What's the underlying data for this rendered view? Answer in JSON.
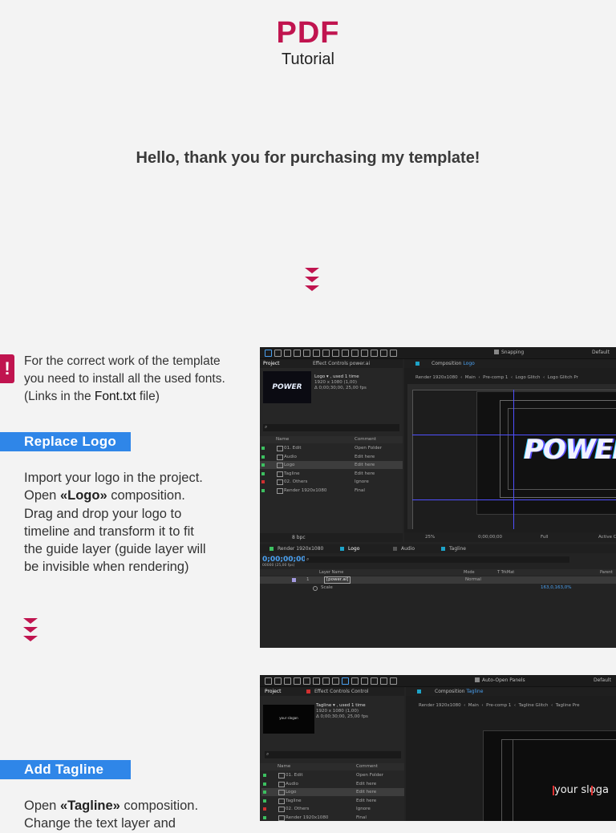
{
  "header": {
    "title": "PDF",
    "subtitle": "Tutorial"
  },
  "intro": {
    "greeting": "Hello, thank you for purchasing my template!"
  },
  "icons": {
    "chevron": "triple-chevron-down-icon",
    "warning": "exclamation-icon"
  },
  "colors": {
    "brand": "#c0144f",
    "banner": "#2f86e8",
    "background": "#f3f3f3"
  },
  "fonts_note": {
    "warning_glyph": "!",
    "line1": "For the correct work of the template",
    "line2": "you need to install all the used fonts.",
    "line3_prefix": "(Links in the ",
    "line3_file": "Font.txt",
    "line3_suffix": " file)"
  },
  "replace_logo": {
    "banner": "Replace Logo",
    "p1": "Import your logo in the project.",
    "p2_prefix": "Open ",
    "p2_bold": "«Logo»",
    "p2_suffix": " composition.",
    "p3": "Drag and drop your logo to",
    "p4": "timeline and transform it to fit",
    "p5": "the guide layer (guide layer will",
    "p6": "be invisible when rendering)"
  },
  "add_tagline": {
    "banner": "Add Tagline",
    "p1_prefix": "Open ",
    "p1_bold": "«Tagline»",
    "p1_suffix": " composition.",
    "p2": "Change the text layer and"
  },
  "ae1": {
    "workspace": "Default",
    "snapping": "Snapping",
    "project_tab": "Project",
    "effect_tab": "Effect Controls power.ai",
    "comp_tab": "Composition",
    "comp_name": "Logo",
    "item_name": "Logo ▾ , used 1 time",
    "item_size": "1920 x 1080 (1,00)",
    "item_dur": "Δ 0;00;30;00, 25,00 fps",
    "thumb_text": "POWER",
    "breadcrumbs": [
      "Render 1920x1080",
      "Main",
      "Pre-comp 1",
      "Logo Glitch",
      "Logo Glitch Pr"
    ],
    "col_name": "Name",
    "col_comment": "Comment",
    "rows": [
      {
        "name": "01. Edit",
        "comment": "Open Folder",
        "color": "#3cc060"
      },
      {
        "name": "Audio",
        "comment": "Edit here",
        "color": "#3cc060"
      },
      {
        "name": "Logo",
        "comment": "Edit here",
        "color": "#3cc060"
      },
      {
        "name": "Tagline",
        "comment": "Edit here",
        "color": "#3cc060"
      },
      {
        "name": "02. Others",
        "comment": "Ignore",
        "color": "#d03030"
      },
      {
        "name": "Render 1920x1080",
        "comment": "Final",
        "color": "#3cc060"
      }
    ],
    "bpc": "8 bpc",
    "zoom": "25%",
    "timecode_small": "0;00;00;00",
    "quality": "Full",
    "active": "Active C",
    "timeline_tabs": [
      "Render 1920x1080",
      "Logo",
      "Audio",
      "Tagline"
    ],
    "timecode": "0;00;00;00",
    "timecode_sub": "00000 (25,00 fps)",
    "tl_col_layer": "Layer Name",
    "tl_col_mode": "Mode",
    "tl_col_trk": "T TrkMat",
    "tl_col_parent": "Parent",
    "layer_num": "1",
    "layer_name": "[power.ai]",
    "layer_mode": "Normal",
    "scale_label": "Scale",
    "scale_value": "163,0,163,0%",
    "canvas_logo": "POWEF"
  },
  "ae2": {
    "workspace": "Default",
    "auto_open": "Auto-Open Panels",
    "project_tab": "Project",
    "effect_tab": "Effect Controls Control",
    "comp_tab": "Composition",
    "comp_name": "Tagline",
    "item_name": "Tagline ▾ , used 1 time",
    "item_size": "1920 x 1080 (1,00)",
    "item_dur": "Δ 0;00;30;00, 25,00 fps",
    "thumb_text": "your slogan",
    "breadcrumbs": [
      "Render 1920x1080",
      "Main",
      "Pre-comp 1",
      "Tagline Glitch",
      "Tagline Pre"
    ],
    "col_name": "Name",
    "col_comment": "Comment",
    "rows": [
      {
        "name": "01. Edit",
        "comment": "Open Folder",
        "color": "#3cc060"
      },
      {
        "name": "Audio",
        "comment": "Edit here",
        "color": "#3cc060"
      },
      {
        "name": "Logo",
        "comment": "Edit here",
        "color": "#3cc060"
      },
      {
        "name": "Tagline",
        "comment": "Edit here",
        "color": "#3cc060"
      },
      {
        "name": "02. Others",
        "comment": "Ignore",
        "color": "#d03030"
      },
      {
        "name": "Render 1920x1080",
        "comment": "Final",
        "color": "#3cc060"
      }
    ],
    "canvas_text": "your sloga"
  }
}
